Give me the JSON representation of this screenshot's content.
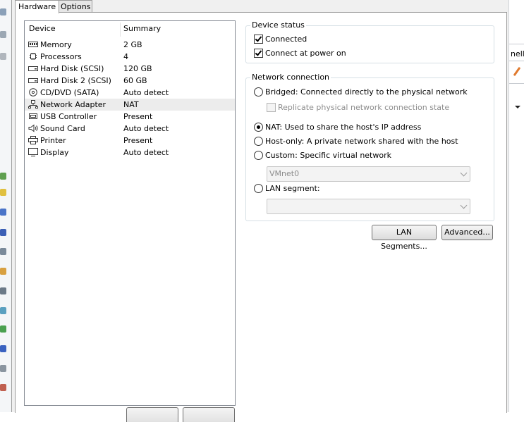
{
  "tabs": {
    "hardware": "Hardware",
    "options": "Options"
  },
  "devices": {
    "header": {
      "device": "Device",
      "summary": "Summary"
    },
    "rows": [
      {
        "name": "Memory",
        "summary": "2 GB",
        "icon": "memory-icon"
      },
      {
        "name": "Processors",
        "summary": "4",
        "icon": "processor-icon"
      },
      {
        "name": "Hard Disk (SCSI)",
        "summary": "120 GB",
        "icon": "hard-disk-icon"
      },
      {
        "name": "Hard Disk 2 (SCSI)",
        "summary": "60 GB",
        "icon": "hard-disk-icon"
      },
      {
        "name": "CD/DVD (SATA)",
        "summary": "Auto detect",
        "icon": "cd-dvd-icon"
      },
      {
        "name": "Network Adapter",
        "summary": "NAT",
        "icon": "network-adapter-icon",
        "selected": true
      },
      {
        "name": "USB Controller",
        "summary": "Present",
        "icon": "usb-icon"
      },
      {
        "name": "Sound Card",
        "summary": "Auto detect",
        "icon": "sound-card-icon"
      },
      {
        "name": "Printer",
        "summary": "Present",
        "icon": "printer-icon"
      },
      {
        "name": "Display",
        "summary": "Auto detect",
        "icon": "display-icon"
      }
    ]
  },
  "device_status": {
    "legend": "Device status",
    "connected": {
      "label": "Connected",
      "checked": true
    },
    "connect_at_power_on": {
      "label": "Connect at power on",
      "checked": true
    }
  },
  "network_connection": {
    "legend": "Network connection",
    "bridged": {
      "label": "Bridged: Connected directly to the physical network",
      "checked": false
    },
    "replicate": {
      "label": "Replicate physical network connection state",
      "checked": false,
      "disabled": true
    },
    "nat": {
      "label": "NAT: Used to share the host's IP address",
      "checked": true
    },
    "host_only": {
      "label": "Host-only: A private network shared with the host",
      "checked": false
    },
    "custom": {
      "label": "Custom: Specific virtual network",
      "checked": false
    },
    "custom_network_select": {
      "value": "VMnet0",
      "disabled": true
    },
    "lan_segment": {
      "label": "LAN segment:",
      "checked": false
    },
    "lan_segment_select": {
      "value": "",
      "disabled": true
    }
  },
  "buttons": {
    "lan_segments": "LAN Segments...",
    "advanced": "Advanced..."
  },
  "background": {
    "right_edge_text": "nelle"
  },
  "colors": {
    "selected_row": "#ececec",
    "group_border": "#d5dfe5",
    "disabled_text": "#8d8d8d"
  }
}
